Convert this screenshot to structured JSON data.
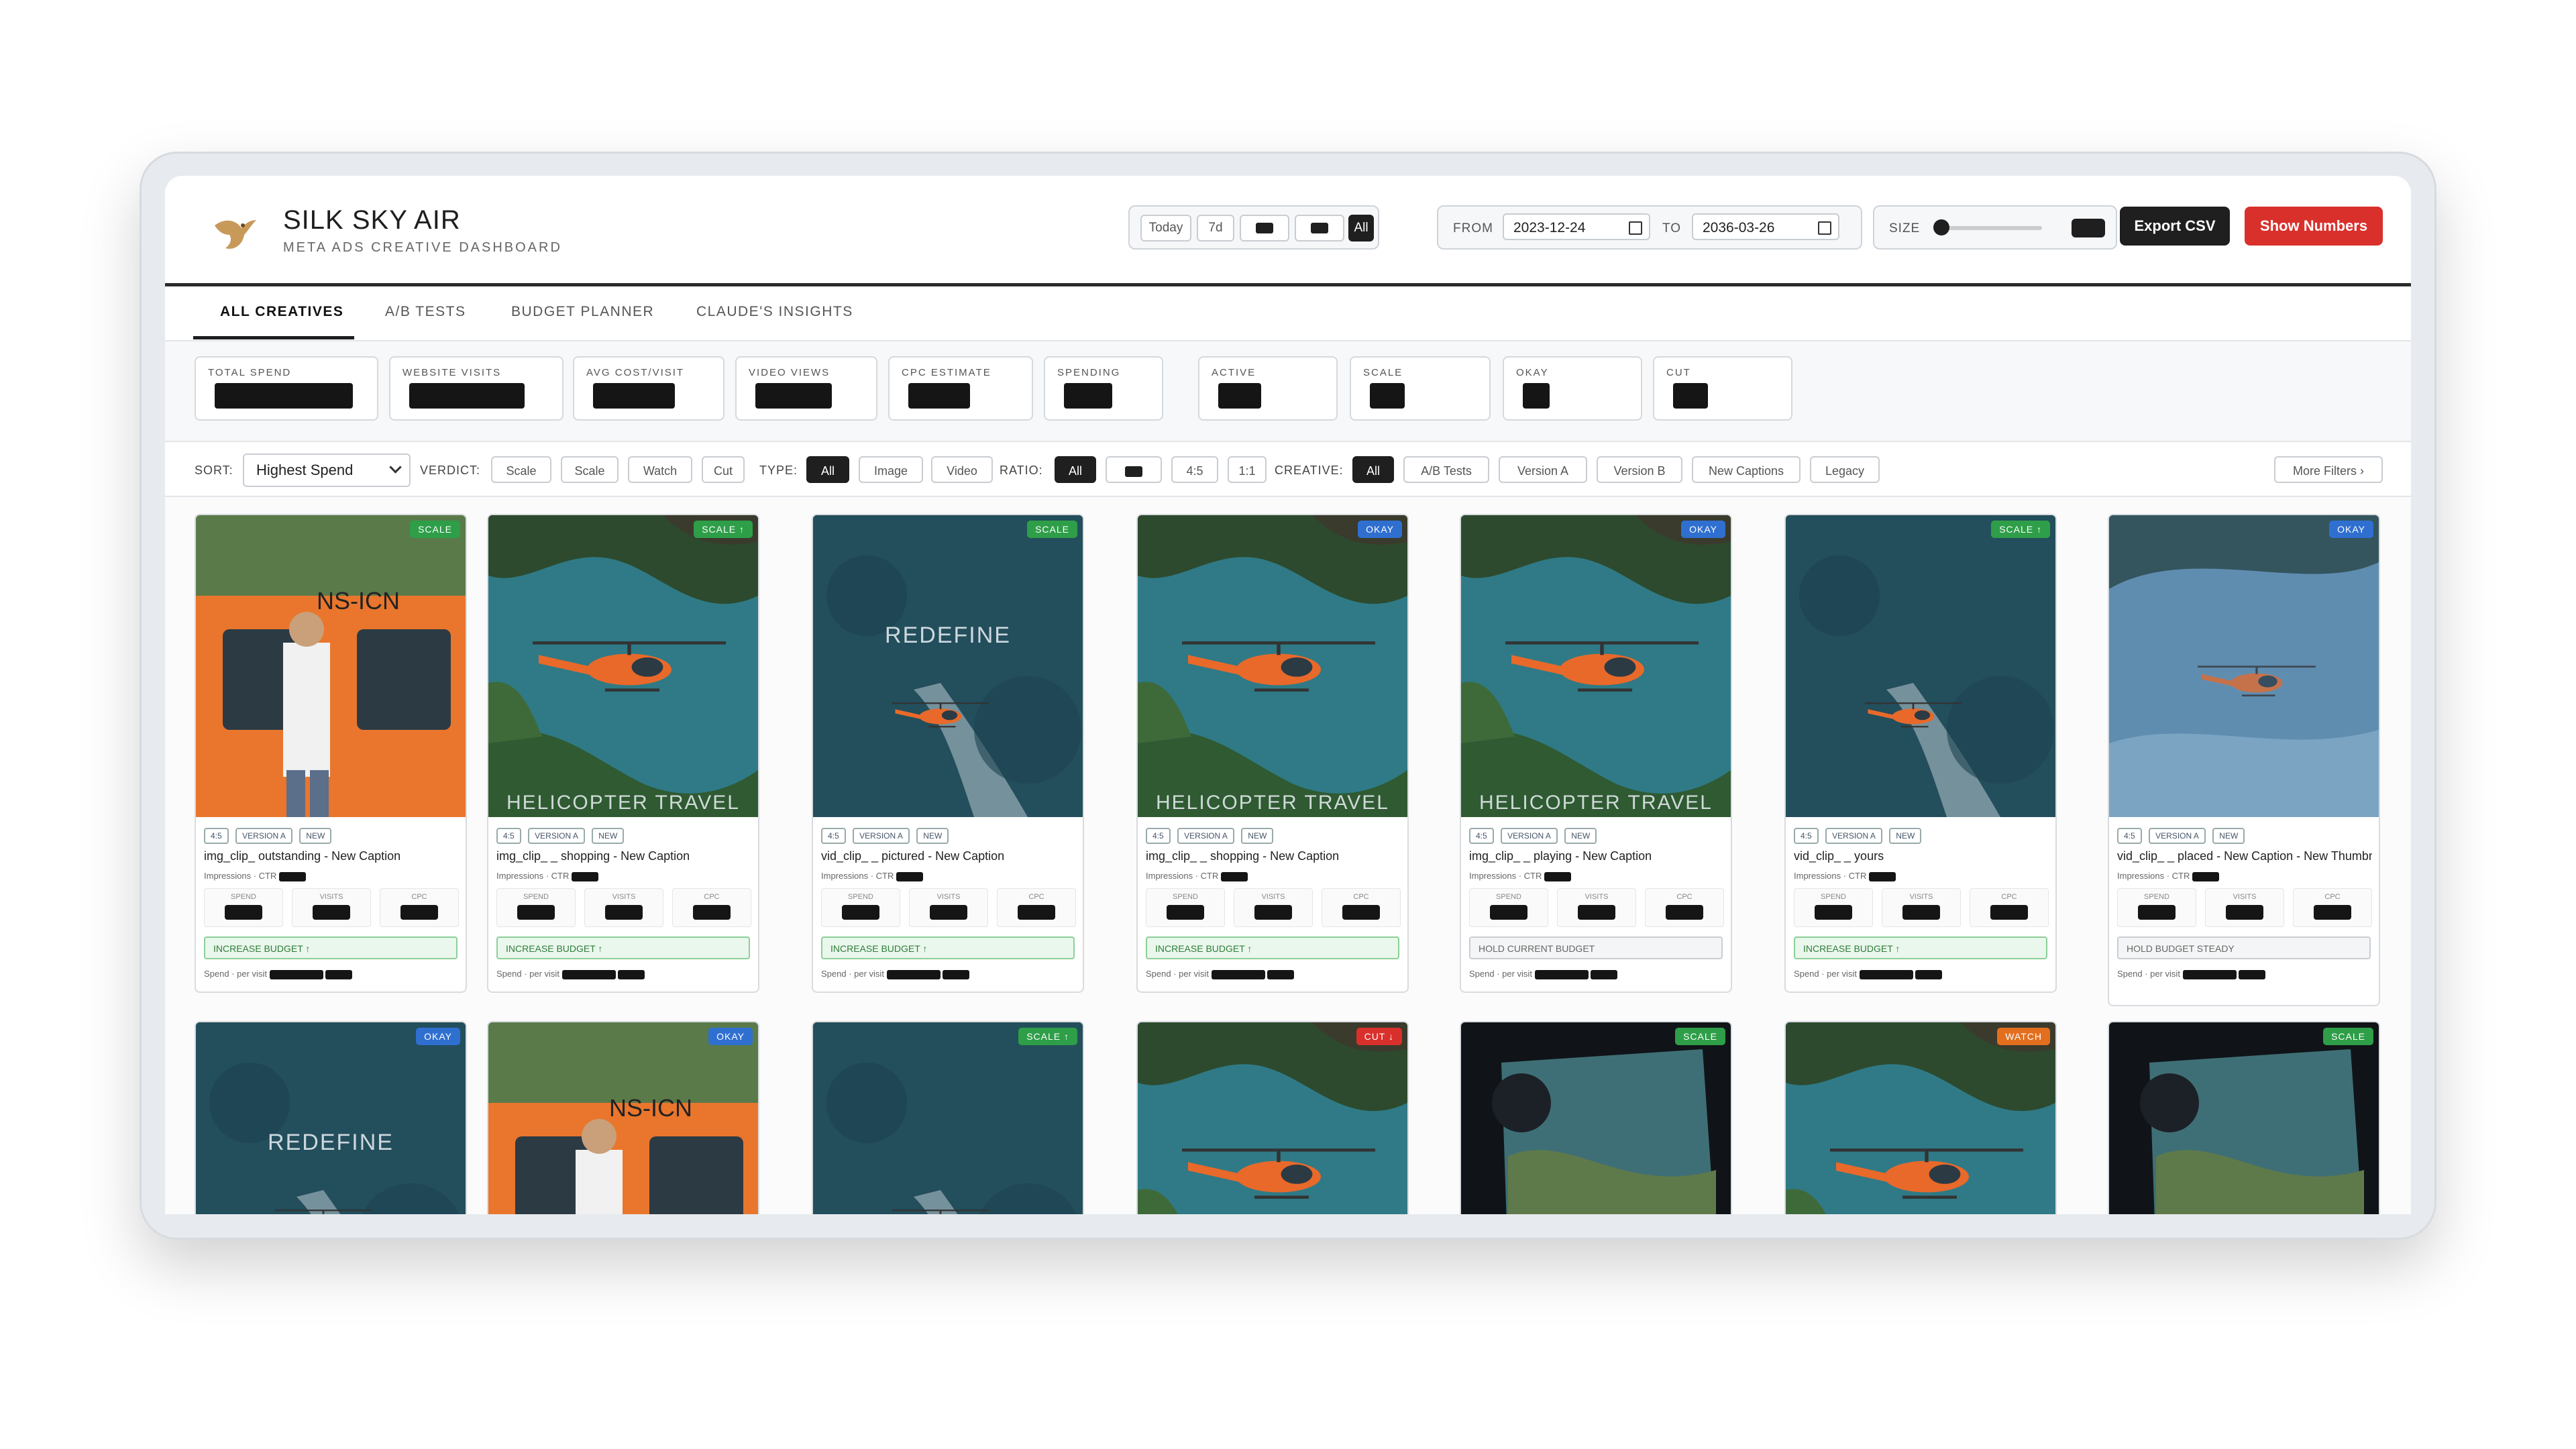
{
  "brand": {
    "title": "SILK SKY AIR",
    "subtitle": "META ADS CREATIVE DASHBOARD"
  },
  "range_buttons": [
    "Today",
    "7d",
    "",
    "",
    "All"
  ],
  "date": {
    "from_label": "FROM",
    "from": "2023-12-24",
    "to_label": "TO",
    "to": "2036-03-26"
  },
  "size": {
    "label": "SIZE",
    "level": 0.0
  },
  "actions": {
    "export": "Export CSV",
    "show_numbers": "Show Numbers"
  },
  "tabs": [
    "ALL CREATIVES",
    "A/B TESTS",
    "BUDGET PLANNER",
    "CLAUDE'S INSIGHTS"
  ],
  "stats": [
    "TOTAL SPEND",
    "WEBSITE VISITS",
    "AVG COST/VISIT",
    "VIDEO VIEWS",
    "CPC ESTIMATE",
    "SPENDING",
    "ACTIVE",
    "SCALE",
    "OKAY",
    "CUT"
  ],
  "filters": {
    "sort_label": "SORT:",
    "sort_value": "Highest Spend",
    "verdict_label": "VERDICT:",
    "verdicts": [
      "Scale",
      "Scale",
      "Watch",
      "Cut"
    ],
    "type_label": "TYPE:",
    "types": [
      "All",
      "Image",
      "Video"
    ],
    "ratio_label": "RATIO:",
    "ratios": [
      "All",
      "",
      "4:5",
      "1:1"
    ],
    "creative_label": "CREATIVE:",
    "creatives": [
      "All",
      "A/B Tests",
      "Version A",
      "Version B",
      "New Captions",
      "Legacy"
    ],
    "more": "More Filters ›"
  },
  "colors": {
    "green": "#2e9e48",
    "blue": "#2f6fd0",
    "red": "#d9302c",
    "dark": "#1f1f1f"
  },
  "cards_row1": [
    {
      "badge": "SCALE",
      "badge_color": "#2e9e48",
      "name": "img_clip_ outstanding - New Caption",
      "verdict": "INCREASE BUDGET ↑",
      "scene": "person",
      "overlay": ""
    },
    {
      "badge": "SCALE ↑",
      "badge_color": "#2e9e48",
      "name": "img_clip_ _ shopping - New Caption",
      "verdict": "INCREASE BUDGET ↑",
      "scene": "bay",
      "overlay": "HELICOPTER TRAVEL"
    },
    {
      "badge": "SCALE",
      "badge_color": "#2e9e48",
      "name": "vid_clip_ _ pictured - New Caption",
      "verdict": "INCREASE BUDGET ↑",
      "scene": "forest",
      "overlay": "REDEFINE"
    },
    {
      "badge": "OKAY",
      "badge_color": "#2f6fd0",
      "name": "img_clip_ _ shopping - New Caption",
      "verdict": "INCREASE BUDGET ↑",
      "scene": "bay",
      "overlay": "HELICOPTER TRAVEL"
    },
    {
      "badge": "OKAY",
      "badge_color": "#2f6fd0",
      "name": "img_clip_ _ playing - New Caption",
      "verdict": "HOLD CURRENT BUDGET",
      "scene": "bay",
      "overlay": "HELICOPTER TRAVEL"
    },
    {
      "badge": "SCALE ↑",
      "badge_color": "#2e9e48",
      "name": "vid_clip_ _ yours",
      "verdict": "INCREASE BUDGET ↑",
      "scene": "forest",
      "overlay": ""
    },
    {
      "badge": "OKAY",
      "badge_color": "#2f6fd0",
      "name": "vid_clip_ _ placed - New Caption - New Thumbnail",
      "verdict": "HOLD BUDGET STEADY",
      "scene": "blur",
      "overlay": ""
    }
  ],
  "cards_row2": [
    {
      "badge": "OKAY",
      "badge_color": "#2f6fd0",
      "scene": "forest",
      "overlay": "REDEFINE"
    },
    {
      "badge": "OKAY",
      "badge_color": "#2f6fd0",
      "scene": "person",
      "overlay": ""
    },
    {
      "badge": "SCALE ↑",
      "badge_color": "#2e9e48",
      "scene": "forest",
      "overlay": ""
    },
    {
      "badge": "CUT ↓",
      "badge_color": "#d9302c",
      "scene": "bay",
      "overlay": ""
    },
    {
      "badge": "SCALE",
      "badge_color": "#2e9e48",
      "scene": "cockpit",
      "overlay": ""
    },
    {
      "badge": "WATCH",
      "badge_color": "#e36f1e",
      "scene": "bay",
      "overlay": ""
    },
    {
      "badge": "SCALE",
      "badge_color": "#2e9e48",
      "scene": "cockpit",
      "overlay": ""
    }
  ],
  "metric_labels": [
    "SPEND",
    "VISITS",
    "CPC"
  ],
  "card_meta": "Impressions  ·  CTR",
  "card_spend": "Spend  ·  per visit"
}
